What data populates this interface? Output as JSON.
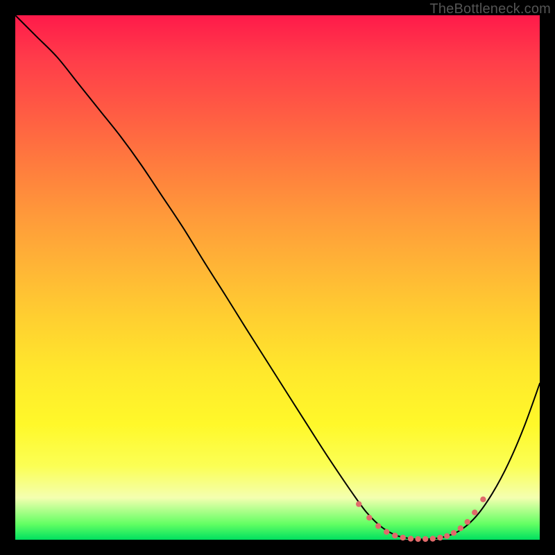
{
  "watermark": "TheBottleneck.com",
  "chart_data": {
    "type": "line",
    "title": "",
    "xlabel": "",
    "ylabel": "",
    "xlim": [
      0,
      100
    ],
    "ylim": [
      0,
      100
    ],
    "grid": false,
    "series": [
      {
        "name": "bottleneck-curve",
        "stroke": "#000000",
        "stroke_width": 2,
        "x": [
          0,
          4,
          8,
          12,
          16,
          20,
          24,
          28,
          32,
          36,
          40,
          44,
          48,
          52,
          56,
          60,
          64,
          67,
          70,
          73,
          76,
          79,
          82,
          85,
          88,
          91,
          94,
          97,
          100
        ],
        "y": [
          100,
          96,
          92,
          87,
          82,
          77,
          71.5,
          65.5,
          59.5,
          53,
          46.7,
          40.3,
          34,
          27.7,
          21.4,
          15.2,
          9.3,
          5.2,
          2.3,
          0.7,
          0.15,
          0.15,
          0.6,
          1.9,
          4.6,
          8.9,
          14.5,
          21.5,
          29.8
        ]
      }
    ],
    "dotted_segment": {
      "name": "optimal-range",
      "color": "#e06a6a",
      "dot_radius": 4.2,
      "x": [
        65.5,
        67.5,
        69.2,
        70.8,
        72.4,
        73.9,
        75.4,
        76.8,
        78.2,
        79.6,
        81.0,
        82.3,
        83.6,
        84.9,
        86.2,
        87.6,
        89.2
      ],
      "y": [
        6.8,
        4.2,
        2.6,
        1.5,
        0.8,
        0.4,
        0.2,
        0.15,
        0.15,
        0.2,
        0.4,
        0.7,
        1.3,
        2.2,
        3.4,
        5.2,
        7.7
      ]
    }
  }
}
